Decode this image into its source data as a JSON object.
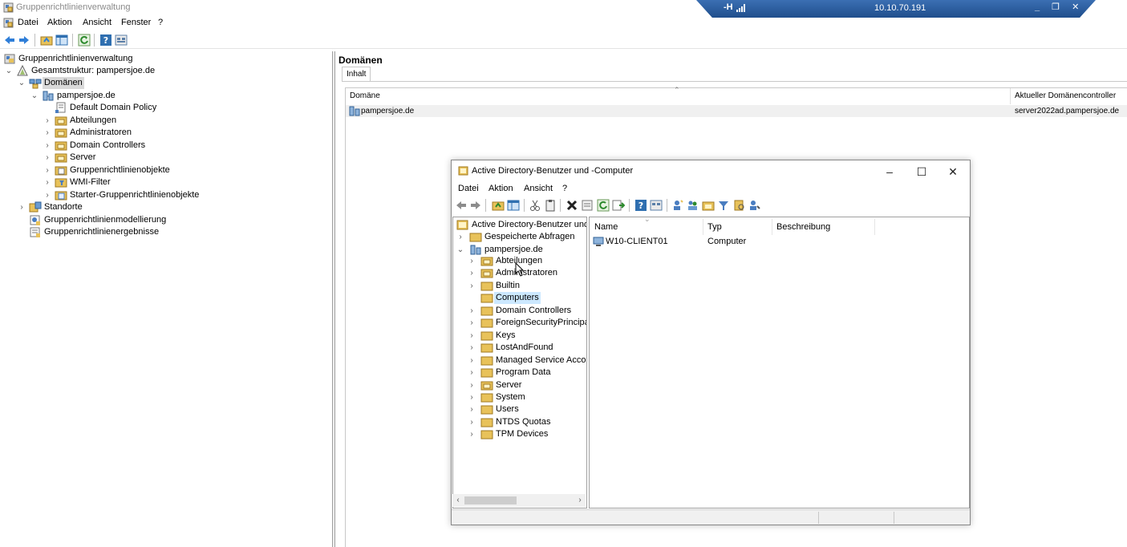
{
  "window": {
    "title": "Gruppenrichtlinienverwaltung"
  },
  "rdp": {
    "ip": "10.10.70.191",
    "pin": "-H",
    "controls": "_ ❐ ✕"
  },
  "menu": {
    "items": [
      "Datei",
      "Aktion",
      "Ansicht",
      "Fenster",
      "?"
    ]
  },
  "tree": {
    "root": "Gruppenrichtlinienverwaltung",
    "forest": "Gesamtstruktur: pampersjoe.de",
    "domains": "Domänen",
    "domain": "pampersjoe.de",
    "children": [
      "Default Domain Policy",
      "Abteilungen",
      "Administratoren",
      "Domain Controllers",
      "Server",
      "Gruppenrichtlinienobjekte",
      "WMI-Filter",
      "Starter-Gruppenrichtlinienobjekte"
    ],
    "sites": "Standorte",
    "modeling": "Gruppenrichtlinienmodellierung",
    "results": "Gruppenrichtlinienergebnisse"
  },
  "right": {
    "title": "Domänen",
    "tab": "Inhalt",
    "columns": [
      "Domäne",
      "Aktueller Domänencontroller"
    ],
    "row": {
      "domain": "pampersjoe.de",
      "dc": "server2022ad.pampersjoe.de"
    }
  },
  "aduc": {
    "title": "Active Directory-Benutzer und -Computer",
    "menu": [
      "Datei",
      "Aktion",
      "Ansicht",
      "?"
    ],
    "tree": {
      "root": "Active Directory-Benutzer und -",
      "saved": "Gespeicherte Abfragen",
      "domain": "pampersjoe.de",
      "items": [
        "Abteilungen",
        "Administratoren",
        "Builtin",
        "Computers",
        "Domain Controllers",
        "ForeignSecurityPrincipals",
        "Keys",
        "LostAndFound",
        "Managed Service Accounts",
        "Program Data",
        "Server",
        "System",
        "Users",
        "NTDS Quotas",
        "TPM Devices"
      ]
    },
    "columns": [
      "Name",
      "Typ",
      "Beschreibung"
    ],
    "rows": [
      {
        "name": "W10-CLIENT01",
        "type": "Computer",
        "desc": ""
      }
    ]
  },
  "colors": {
    "accent": "#1f4e8c",
    "folder": "#e8c25a",
    "selection": "#cce8ff"
  }
}
